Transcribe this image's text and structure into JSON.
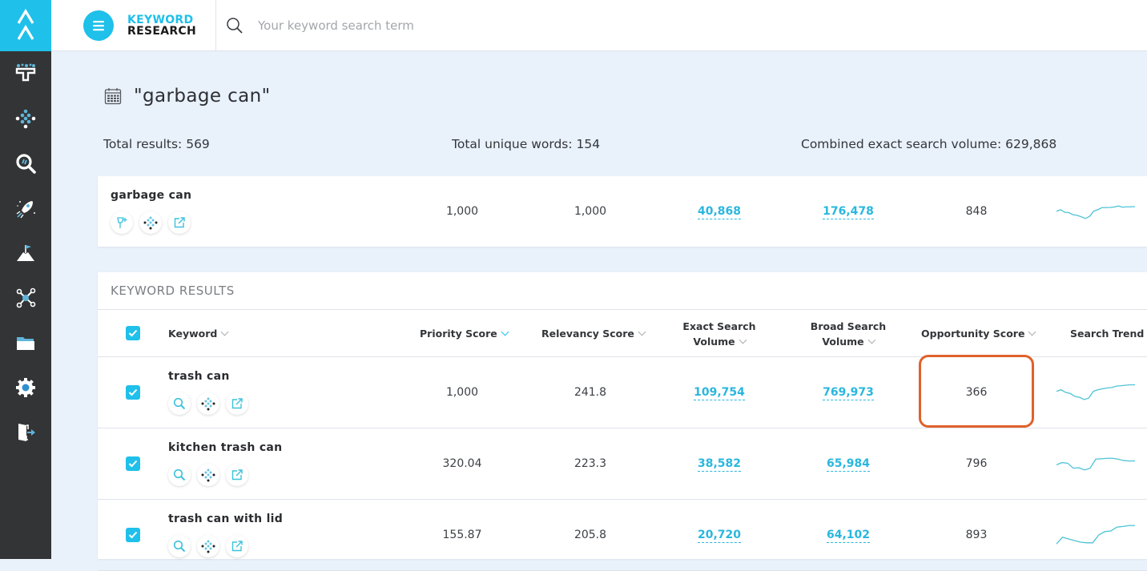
{
  "app": {
    "brand_line1": "KEYWORD",
    "brand_line2": "RESEARCH",
    "search_placeholder": "Your keyword search term",
    "search_value": ""
  },
  "sidebar": {
    "items": [
      {
        "icon": "funnel-icon",
        "label": "Keyword funnel"
      },
      {
        "icon": "cluster-icon",
        "label": "Keyword cluster"
      },
      {
        "icon": "search-analysis-icon",
        "label": "Search"
      },
      {
        "icon": "rocket-icon",
        "label": "Launch"
      },
      {
        "icon": "mountain-flag-icon",
        "label": "Goals"
      },
      {
        "icon": "network-icon",
        "label": "Network"
      },
      {
        "icon": "folder-icon",
        "label": "Folder"
      },
      {
        "icon": "gear-icon",
        "label": "Settings"
      },
      {
        "icon": "logout-icon",
        "label": "Logout"
      }
    ]
  },
  "page": {
    "title": "\"garbage can\"",
    "stats": {
      "total_results": "Total results: 569",
      "unique_words": "Total unique words: 154",
      "combined_volume": "Combined exact search volume: 629,868"
    }
  },
  "seed": {
    "keyword": "garbage can",
    "priority_score": "1,000",
    "relevancy_score": "1,000",
    "exact_search_volume": "40,868",
    "broad_search_volume": "176,478",
    "opportunity_score": "848",
    "trend": [
      0.55,
      0.62,
      0.5,
      0.48,
      0.38,
      0.35,
      0.28,
      0.2,
      0.3,
      0.55,
      0.62,
      0.72,
      0.72,
      0.73,
      0.75,
      0.8,
      0.74,
      0.76,
      0.76,
      0.77
    ]
  },
  "results": {
    "section_title": "KEYWORD RESULTS",
    "columns": {
      "keyword": "Keyword",
      "priority": "Priority Score",
      "relevancy": "Relevancy Score",
      "exact_l1": "Exact Search",
      "exact_l2": "Volume",
      "broad_l1": "Broad Search",
      "broad_l2": "Volume",
      "opportunity": "Opportunity Score",
      "trend": "Search Trend"
    },
    "sort_column": "priority",
    "rows": [
      {
        "keyword": "trash can",
        "checked": true,
        "priority_score": "1,000",
        "relevancy_score": "241.8",
        "exact_search_volume": "109,754",
        "broad_search_volume": "769,973",
        "opportunity_score": "366",
        "highlighted": true,
        "trend": [
          0.55,
          0.62,
          0.5,
          0.45,
          0.32,
          0.28,
          0.18,
          0.25,
          0.55,
          0.62,
          0.66,
          0.7,
          0.72,
          0.78,
          0.8,
          0.82,
          0.84,
          0.84
        ]
      },
      {
        "keyword": "kitchen trash can",
        "checked": true,
        "priority_score": "320.04",
        "relevancy_score": "223.3",
        "exact_search_volume": "38,582",
        "broad_search_volume": "65,984",
        "opportunity_score": "796",
        "highlighted": false,
        "trend": [
          0.45,
          0.55,
          0.52,
          0.3,
          0.32,
          0.22,
          0.3,
          0.7,
          0.72,
          0.74,
          0.74,
          0.7,
          0.64,
          0.62,
          0.62
        ]
      },
      {
        "keyword": "trash can with lid",
        "checked": true,
        "priority_score": "155.87",
        "relevancy_score": "205.8",
        "exact_search_volume": "20,720",
        "broad_search_volume": "64,102",
        "opportunity_score": "893",
        "highlighted": false,
        "trend": [
          0.1,
          0.4,
          0.32,
          0.25,
          0.18,
          0.15,
          0.15,
          0.5,
          0.65,
          0.68,
          0.85,
          0.88,
          0.92,
          0.92
        ]
      }
    ]
  }
}
